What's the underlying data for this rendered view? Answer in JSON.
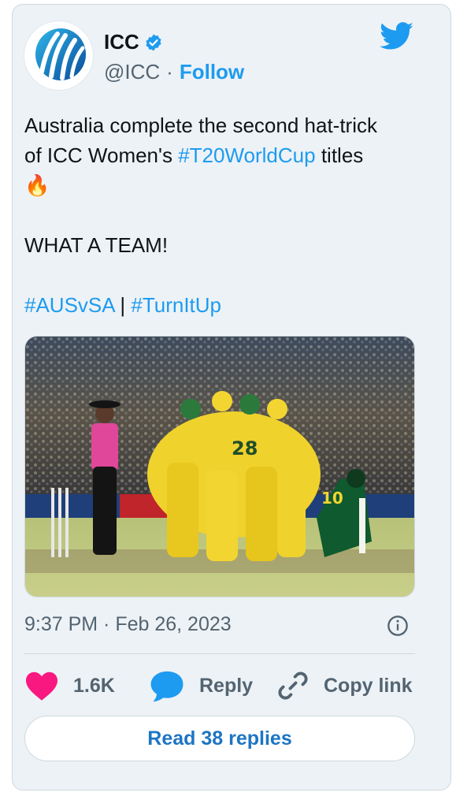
{
  "author": {
    "name": "ICC",
    "handle": "@ICC",
    "follow_label": "Follow",
    "verified": true
  },
  "tweet": {
    "line1": "Australia complete the second hat-trick",
    "line2_prefix": "of ICC Women's ",
    "line2_hashtag": "#T20WorldCup",
    "line2_suffix": " titles",
    "emoji": "🔥",
    "line4": "WHAT A TEAM!",
    "hashtag1": "#AUSvSA",
    "separator": " | ",
    "hashtag2": "#TurnItUp"
  },
  "timestamp": "9:37 PM · Feb 26, 2023",
  "actions": {
    "likes": "1.6K",
    "reply_label": "Reply",
    "copy_label": "Copy link"
  },
  "read_replies_label": "Read 38 replies",
  "colors": {
    "accent": "#1d9bf0",
    "heart": "#f91880",
    "card_bg": "#edf2f6"
  },
  "icons": [
    "icc-logo",
    "verified-badge-icon",
    "twitter-bird-icon",
    "info-icon",
    "heart-icon",
    "reply-bubble-icon",
    "link-icon"
  ]
}
